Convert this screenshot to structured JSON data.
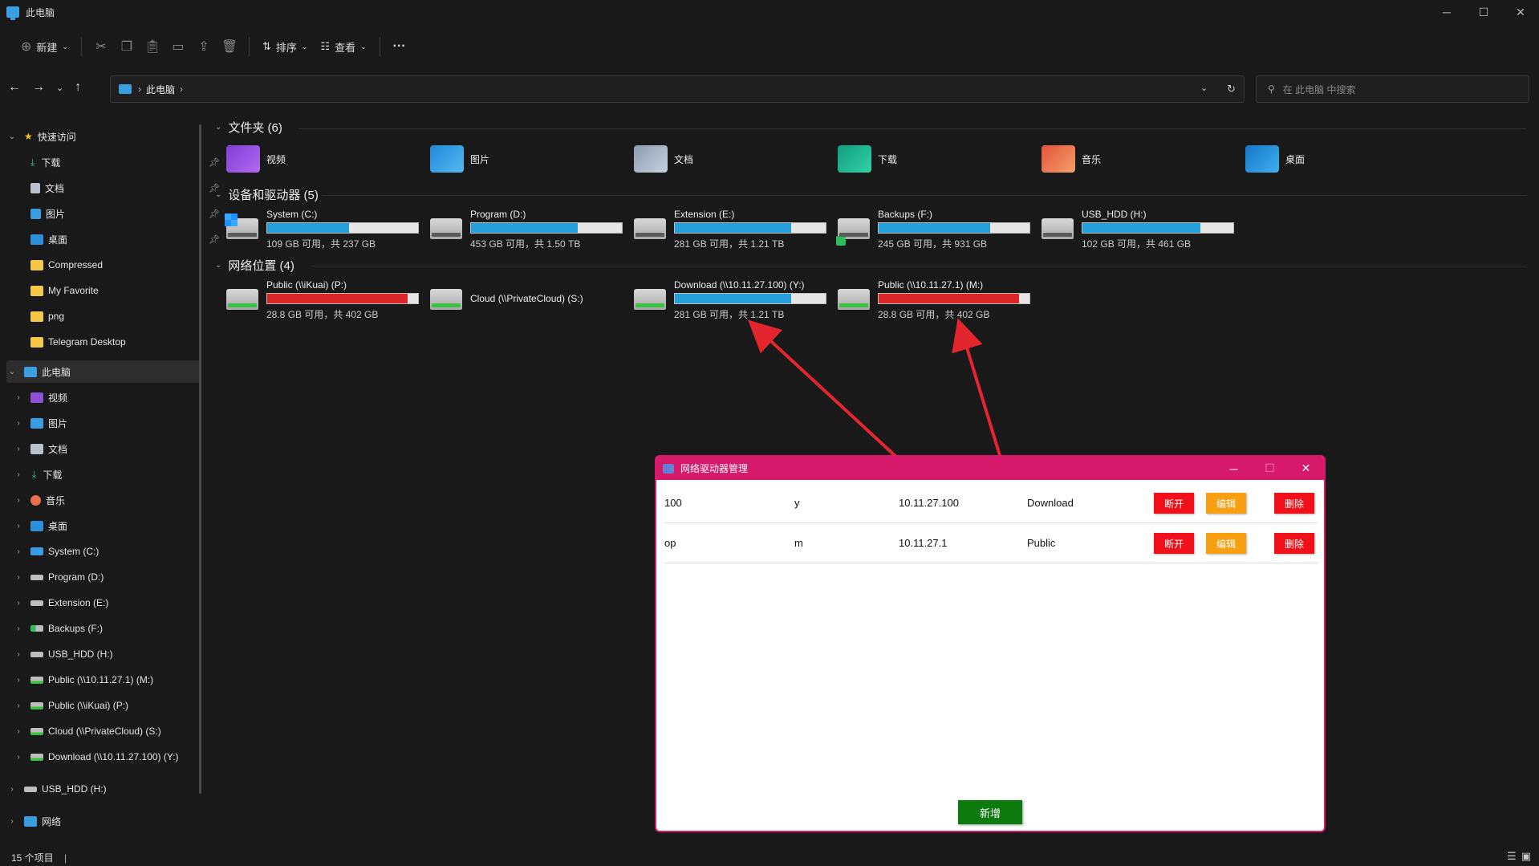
{
  "window": {
    "title": "此电脑"
  },
  "toolbar": {
    "new_label": "新建",
    "sort_label": "排序",
    "view_label": "查看"
  },
  "address": {
    "crumb": "此电脑",
    "search_placeholder": "在 此电脑 中搜索"
  },
  "sidebar": {
    "quick_access": "快速访问",
    "pinned": [
      "下载",
      "文档",
      "图片",
      "桌面"
    ],
    "folders": [
      "Compressed",
      "My Favorite",
      "png",
      "Telegram Desktop"
    ],
    "this_pc": "此电脑",
    "pc_items": [
      "视频",
      "图片",
      "文档",
      "下载",
      "音乐",
      "桌面",
      "System (C:)",
      "Program (D:)",
      "Extension (E:)",
      "Backups (F:)",
      "USB_HDD (H:)",
      "Public (\\\\10.11.27.1) (M:)",
      "Public (\\\\iKuai) (P:)",
      "Cloud (\\\\PrivateCloud) (S:)",
      "Download (\\\\10.11.27.100) (Y:)"
    ],
    "usb": "USB_HDD (H:)",
    "network": "网络"
  },
  "groups": {
    "folders": "文件夹 (6)",
    "drives": "设备和驱动器 (5)",
    "network": "网络位置 (4)"
  },
  "folders": [
    "视频",
    "图片",
    "文档",
    "下载",
    "音乐",
    "桌面"
  ],
  "drives": [
    {
      "name": "System (C:)",
      "space": "109 GB 可用，共 237 GB",
      "used": 0.54,
      "color": "#26a0da"
    },
    {
      "name": "Program (D:)",
      "space": "453 GB 可用，共 1.50 TB",
      "used": 0.71,
      "color": "#26a0da"
    },
    {
      "name": "Extension (E:)",
      "space": "281 GB 可用，共 1.21 TB",
      "used": 0.77,
      "color": "#26a0da"
    },
    {
      "name": "Backups (F:)",
      "space": "245 GB 可用，共 931 GB",
      "used": 0.74,
      "color": "#26a0da"
    },
    {
      "name": "USB_HDD (H:)",
      "space": "102 GB 可用，共 461 GB",
      "used": 0.78,
      "color": "#26a0da"
    }
  ],
  "network_drives": [
    {
      "name": "Public (\\\\iKuai) (P:)",
      "space": "28.8 GB 可用，共 402 GB",
      "used": 0.93,
      "color": "#da2626"
    },
    {
      "name": "Cloud (\\\\PrivateCloud) (S:)",
      "space": "",
      "used": 0
    },
    {
      "name": "Download (\\\\10.11.27.100) (Y:)",
      "space": "281 GB 可用，共 1.21 TB",
      "used": 0.77,
      "color": "#26a0da"
    },
    {
      "name": "Public (\\\\10.11.27.1) (M:)",
      "space": "28.8 GB 可用，共 402 GB",
      "used": 0.93,
      "color": "#da2626"
    }
  ],
  "status": {
    "count": "15 个项目"
  },
  "dialog": {
    "title": "网络驱动器管理",
    "rows": [
      {
        "name": "100",
        "letter": "y",
        "ip": "10.11.27.100",
        "share": "Download"
      },
      {
        "name": "op",
        "letter": "m",
        "ip": "10.11.27.1",
        "share": "Public"
      }
    ],
    "disconnect_label": "断开",
    "edit_label": "编辑",
    "delete_label": "删除",
    "add_label": "新增"
  }
}
